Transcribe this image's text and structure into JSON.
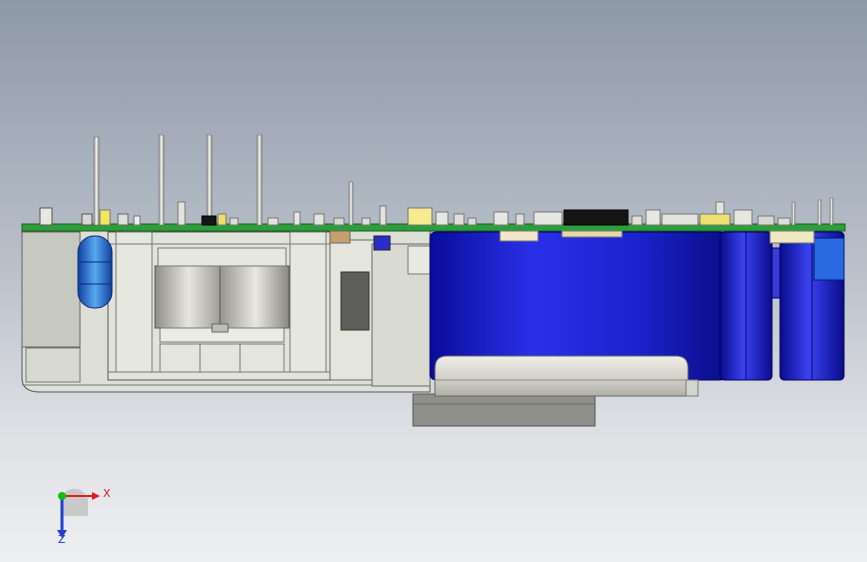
{
  "triad": {
    "x_label": "X",
    "z_label": "Z"
  },
  "colors": {
    "pcb": "#2e9e3a",
    "capacitor": "#1a1fd0",
    "housing": "#ddded5",
    "base_plate": "#8a8b84",
    "x_axis": "#e02020",
    "y_axis": "#18b818",
    "z_axis": "#2040d0"
  }
}
